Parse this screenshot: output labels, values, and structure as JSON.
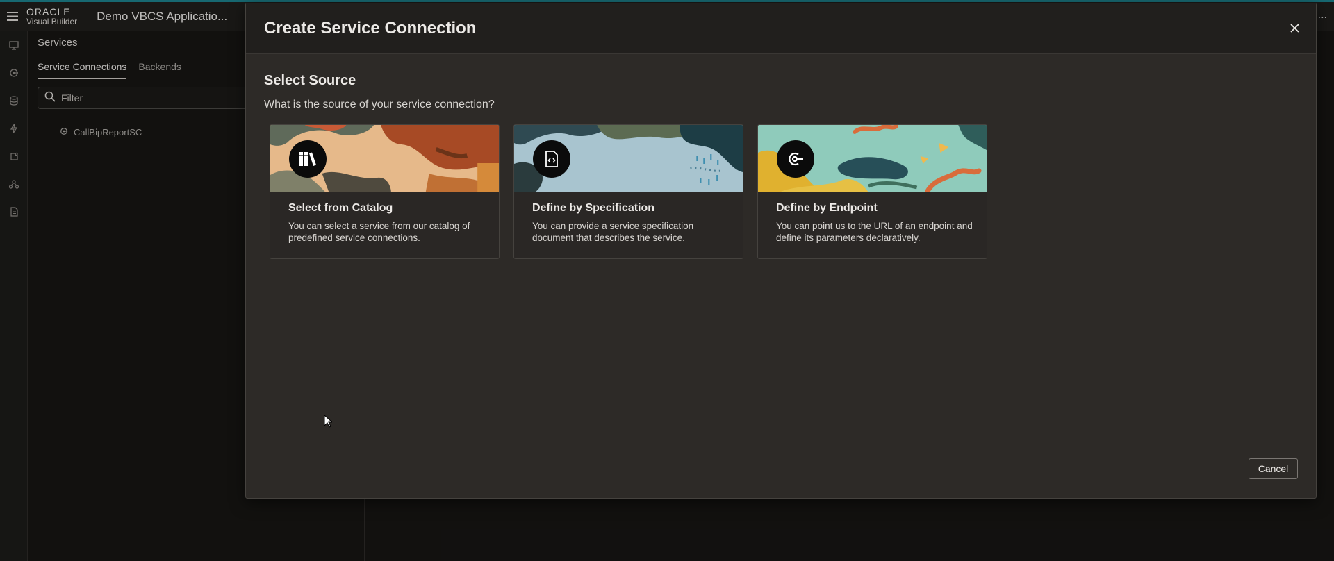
{
  "header": {
    "logo_line1": "ORACLE",
    "logo_line2": "Visual Builder",
    "app_title": "Demo VBCS Applicatio...",
    "more_label": "..."
  },
  "sidebar": {
    "title": "Services",
    "tabs": [
      {
        "label": "Service Connections",
        "active": true
      },
      {
        "label": "Backends",
        "active": false
      }
    ],
    "filter_placeholder": "Filter",
    "items": [
      {
        "label": "CallBipReportSC",
        "icon": "service-connection-icon"
      }
    ]
  },
  "rail": {
    "icons": [
      "web-app-icon",
      "service-connection-icon",
      "database-icon",
      "lightning-icon",
      "component-icon",
      "process-icon",
      "document-icon"
    ]
  },
  "dialog": {
    "title": "Create Service Connection",
    "section_title": "Select Source",
    "section_subtitle": "What is the source of your service connection?",
    "cards": [
      {
        "title": "Select from Catalog",
        "description": "You can select a service from our catalog of predefined service connections.",
        "icon": "catalog-icon"
      },
      {
        "title": "Define by Specification",
        "description": "You can provide a service specification document that describes the service.",
        "icon": "specification-document-icon"
      },
      {
        "title": "Define by Endpoint",
        "description": "You can point us to the URL of an endpoint and define its parameters declaratively.",
        "icon": "endpoint-icon"
      }
    ],
    "cancel_label": "Cancel"
  },
  "colors": {
    "background": "#161513",
    "dialog": "#2d2a27",
    "accent": "#1d7f8a"
  }
}
